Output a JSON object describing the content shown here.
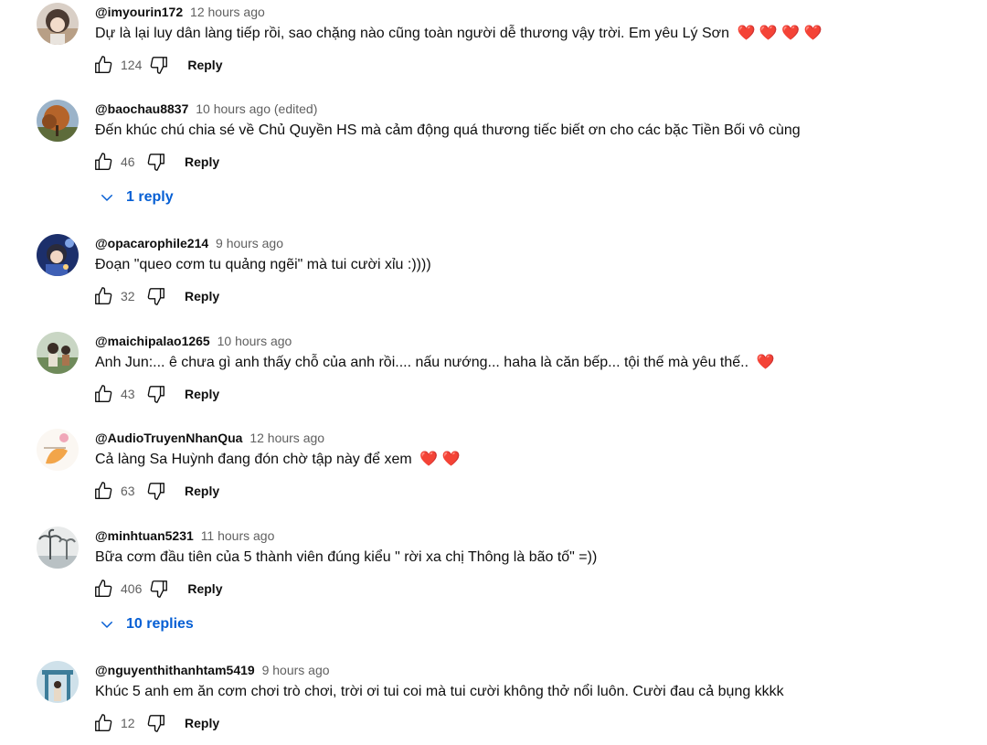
{
  "comments": [
    {
      "author": "@imyourin172",
      "time": "12 hours ago",
      "text": "Dự là lại luy dân làng tiếp rồi, sao chặng nào cũng toàn người dễ thương vậy trời. Em yêu Lý Sơn",
      "hearts": "❤️ ❤️ ❤️ ❤️",
      "likes": "124",
      "reply_label": "Reply",
      "avatar_icon": "avatar-girl-icon"
    },
    {
      "author": "@baochau8837",
      "time": "10 hours ago (edited)",
      "text": "Đến khúc chú chia sé về Chủ Quyền HS mà cảm động quá thương tiếc biết ơn cho các bặc Tiền Bối vô cùng",
      "hearts": "",
      "likes": "46",
      "reply_label": "Reply",
      "replies_label": "1 reply",
      "avatar_icon": "avatar-tree-icon"
    },
    {
      "author": "@opacarophile214",
      "time": "9 hours ago",
      "text": "Đoạn \"queo cơm tu quảng ngẽi\" mà tui cười xỉu :))))",
      "hearts": "",
      "likes": "32",
      "reply_label": "Reply",
      "avatar_icon": "avatar-anime-icon"
    },
    {
      "author": "@maichipalao1265",
      "time": "10 hours ago",
      "text": "Anh Jun:... ê chưa gì anh thấy chỗ của anh rồi.... nấu nướng... haha là căn bếp... tội thế mà yêu thế..",
      "hearts": "❤️",
      "likes": "43",
      "reply_label": "Reply",
      "avatar_icon": "avatar-outdoor-icon"
    },
    {
      "author": "@AudioTruyenNhanQua",
      "time": "12 hours ago",
      "text": "Cả làng Sa Huỳnh đang đón chờ tập này để xem",
      "hearts": "❤️ ❤️",
      "likes": "63",
      "reply_label": "Reply",
      "avatar_icon": "avatar-logo-icon"
    },
    {
      "author": "@minhtuan5231",
      "time": "11 hours ago",
      "text": "Bữa cơm đầu tiên của 5 thành viên đúng kiểu \" rời xa chị Thông là bão tố\" =))",
      "hearts": "",
      "likes": "406",
      "reply_label": "Reply",
      "replies_label": "10 replies",
      "avatar_icon": "avatar-palm-icon"
    },
    {
      "author": "@nguyenthithanhtam5419",
      "time": "9 hours ago",
      "text": "Khúc 5 anh em ăn cơm chơi trò chơi, trời ơi tui coi mà tui cười không thở nổi luôn. Cười đau cả bụng kkkk",
      "hearts": "",
      "likes": "12",
      "reply_label": "Reply",
      "avatar_icon": "avatar-gate-icon"
    }
  ],
  "colors": {
    "link_blue": "#065fd4",
    "heart_red": "#e22b2b",
    "secondary_text": "#606060"
  }
}
